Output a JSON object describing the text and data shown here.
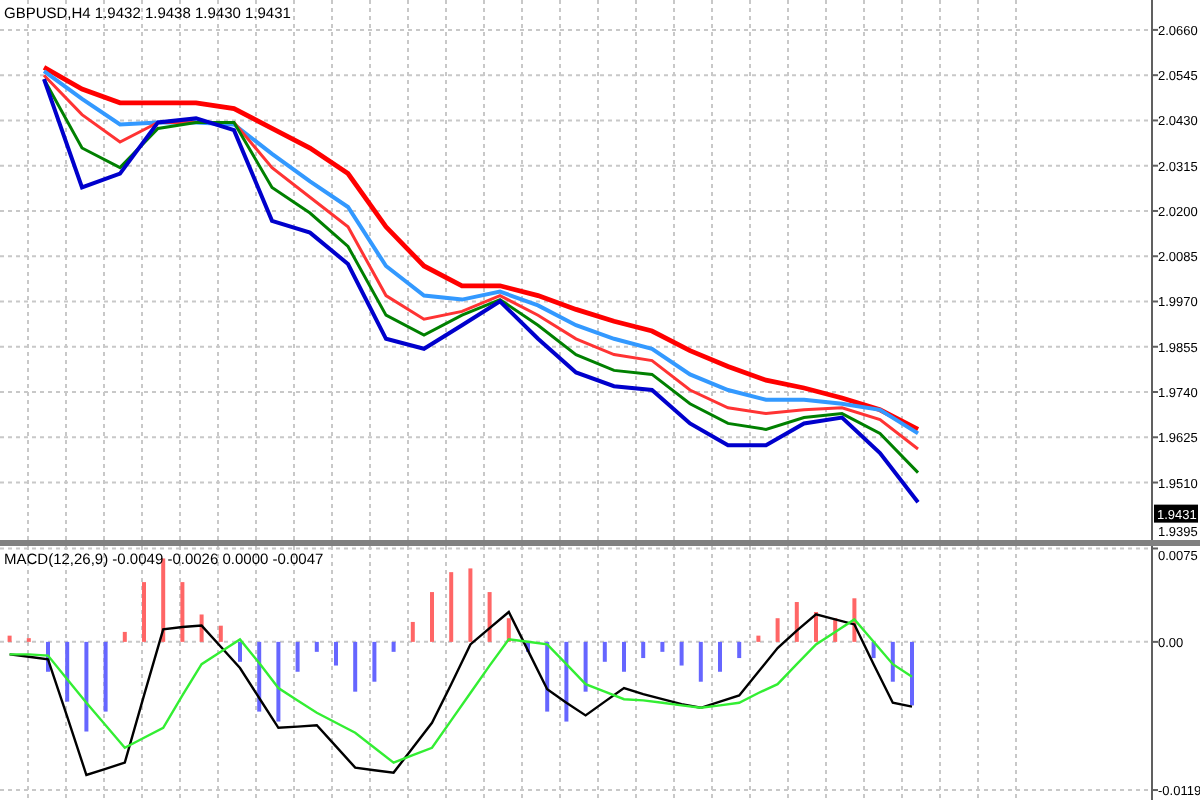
{
  "main_chart": {
    "header": "GBPUSD,H4 1.9432 1.9438 1.9430 1.9431",
    "current_price": "1.9431",
    "cut_label": "1.9395",
    "chart_data": {
      "type": "line",
      "grid": true,
      "ylim": [
        1.9364,
        2.0736
      ],
      "yticks": [
        {
          "value": 2.066,
          "label": "2.0660"
        },
        {
          "value": 2.0545,
          "label": "2.0545"
        },
        {
          "value": 2.043,
          "label": "2.0430"
        },
        {
          "value": 2.0315,
          "label": "2.0315"
        },
        {
          "value": 2.02,
          "label": "2.0200"
        },
        {
          "value": 2.0085,
          "label": "2.0085"
        },
        {
          "value": 1.997,
          "label": "1.9970"
        },
        {
          "value": 1.9855,
          "label": "1.9855"
        },
        {
          "value": 1.974,
          "label": "1.9740"
        },
        {
          "value": 1.9625,
          "label": "1.9625"
        },
        {
          "value": 1.951,
          "label": "1.9510"
        }
      ],
      "series": [
        {
          "color": "#ff0000",
          "values": [
            2.0565,
            2.051,
            2.0475,
            2.0475,
            2.0475,
            2.046,
            2.041,
            2.036,
            2.0295,
            2.016,
            2.006,
            2.001,
            2.001,
            1.9985,
            1.995,
            1.992,
            1.9895,
            1.9845,
            1.9805,
            1.977,
            1.975,
            1.9725,
            1.9695,
            1.9645
          ]
        },
        {
          "color": "#3399ff",
          "values": [
            2.0555,
            2.0485,
            2.042,
            2.0425,
            2.0425,
            2.042,
            2.0345,
            2.0275,
            2.021,
            2.006,
            1.9985,
            1.9975,
            1.9995,
            1.996,
            1.991,
            1.9875,
            1.985,
            1.9785,
            1.9745,
            1.972,
            1.972,
            1.971,
            1.9695,
            1.9635
          ]
        },
        {
          "color": "#ff3333",
          "values": [
            2.0545,
            2.0445,
            2.0375,
            2.0425,
            2.0425,
            2.0425,
            2.031,
            2.0235,
            2.016,
            1.9985,
            1.9925,
            1.9945,
            1.9985,
            1.9935,
            1.9875,
            1.9835,
            1.982,
            1.9745,
            1.97,
            1.9685,
            1.9695,
            1.97,
            1.967,
            1.9595
          ]
        },
        {
          "color": "#008000",
          "values": [
            2.0535,
            2.036,
            2.031,
            2.041,
            2.0425,
            2.0425,
            2.026,
            2.0195,
            2.011,
            1.9935,
            1.9885,
            1.9935,
            1.9975,
            1.991,
            1.9835,
            1.9795,
            1.9785,
            1.971,
            1.966,
            1.9645,
            1.9675,
            1.9685,
            1.9635,
            1.9535
          ]
        },
        {
          "color": "#0000cc",
          "values": [
            2.0535,
            2.026,
            2.0295,
            2.0425,
            2.0435,
            2.0405,
            2.0175,
            2.0145,
            2.0065,
            1.9875,
            1.985,
            1.991,
            1.997,
            1.9875,
            1.979,
            1.9755,
            1.9745,
            1.966,
            1.9605,
            1.9605,
            1.966,
            1.9675,
            1.9585,
            1.946
          ]
        }
      ]
    }
  },
  "indicator_chart": {
    "header": "MACD(12,26,9) -0.0049 -0.0026 0.0000 -0.0047",
    "chart_data": {
      "type": "bar",
      "grid": true,
      "ylim": [
        -0.0127,
        0.0077
      ],
      "yticks": [
        {
          "value": 0.0075,
          "label": "0.0075"
        },
        {
          "value": 0,
          "label": "0.00"
        },
        {
          "value": -0.0119,
          "label": "-0.0119"
        }
      ],
      "series": [
        {
          "color": "#ff6666",
          "values": [
            0.0005,
            0.0003,
            null,
            null,
            null,
            null,
            0.0008,
            0.0048,
            0.0067,
            0.0048,
            0.0022,
            0.0013,
            null,
            null,
            null,
            null,
            null,
            null,
            null,
            null,
            null,
            0.0016,
            0.004,
            0.0056,
            0.0059,
            0.004,
            0.0019,
            null,
            null,
            null,
            null,
            null,
            null,
            null,
            null,
            null,
            null,
            null,
            null,
            0.0005,
            0.0019,
            0.0032,
            0.0024,
            0.0019,
            0.0035,
            null,
            null,
            null,
            null,
            null,
            null,
            null,
            null,
            null,
            null,
            null,
            null,
            null,
            null,
            null
          ]
        },
        {
          "color": "#6666ff",
          "values": [
            null,
            null,
            -0.0024,
            -0.0048,
            -0.0072,
            -0.0056,
            null,
            null,
            null,
            null,
            null,
            null,
            -0.0016,
            -0.0056,
            -0.0064,
            -0.0024,
            -0.0008,
            -0.0019,
            -0.004,
            -0.0032,
            -0.0008,
            null,
            null,
            null,
            null,
            null,
            null,
            -0.0008,
            -0.0056,
            -0.0064,
            -0.004,
            -0.0016,
            -0.0024,
            -0.0013,
            -0.0008,
            -0.0019,
            -0.0032,
            -0.0024,
            -0.0013,
            null,
            null,
            null,
            null,
            null,
            null,
            -0.0013,
            -0.0032,
            -0.0051,
            null,
            null,
            null,
            null,
            null,
            null,
            null,
            null,
            null,
            null,
            null,
            null
          ]
        },
        {
          "type": "line",
          "color": "#000000",
          "values": [
            -0.001,
            -0.0012,
            -0.0014,
            -0.006,
            -0.0107,
            -0.0102,
            -0.0097,
            -0.0043,
            0.001,
            0.0012,
            0.0013,
            -0.0004,
            -0.0021,
            -0.0045,
            -0.0069,
            -0.0068,
            -0.0067,
            -0.0084,
            -0.0101,
            -0.0103,
            -0.0105,
            -0.0085,
            -0.0065,
            -0.0034,
            -0.0002,
            0.0011,
            0.0024,
            -0.0007,
            -0.0038,
            -0.0049,
            -0.0059,
            -0.0048,
            -0.0037,
            -0.0042,
            -0.0046,
            -0.005,
            -0.0053,
            -0.0048,
            -0.0043,
            -0.0024,
            -0.0005,
            0.0009,
            0.0022,
            0.0018,
            0.0014,
            -0.0018,
            -0.0049,
            -0.0052,
            null,
            null,
            null,
            null,
            null,
            null,
            null,
            null,
            null,
            null,
            null,
            null
          ]
        },
        {
          "type": "line",
          "color": "#33ee33",
          "values": [
            -0.001,
            -0.001,
            -0.0011,
            -0.003,
            -0.0049,
            -0.0067,
            -0.0085,
            -0.0077,
            -0.0069,
            -0.0043,
            -0.0018,
            -0.0008,
            0.0002,
            -0.0017,
            -0.0037,
            -0.0047,
            -0.0057,
            -0.0065,
            -0.0073,
            -0.0085,
            -0.0097,
            -0.0091,
            -0.0085,
            -0.0063,
            -0.0041,
            -0.0019,
            0.0002,
            0.0,
            -0.0002,
            -0.0018,
            -0.0034,
            -0.004,
            -0.0046,
            -0.0047,
            -0.0049,
            -0.0051,
            -0.0053,
            -0.0051,
            -0.0049,
            -0.0041,
            -0.0034,
            -0.0018,
            -0.0002,
            0.0008,
            0.0018,
            0.0,
            -0.0018,
            -0.0028,
            null,
            null,
            null,
            null,
            null,
            null,
            null,
            null,
            null,
            null,
            null,
            null
          ]
        }
      ]
    }
  }
}
